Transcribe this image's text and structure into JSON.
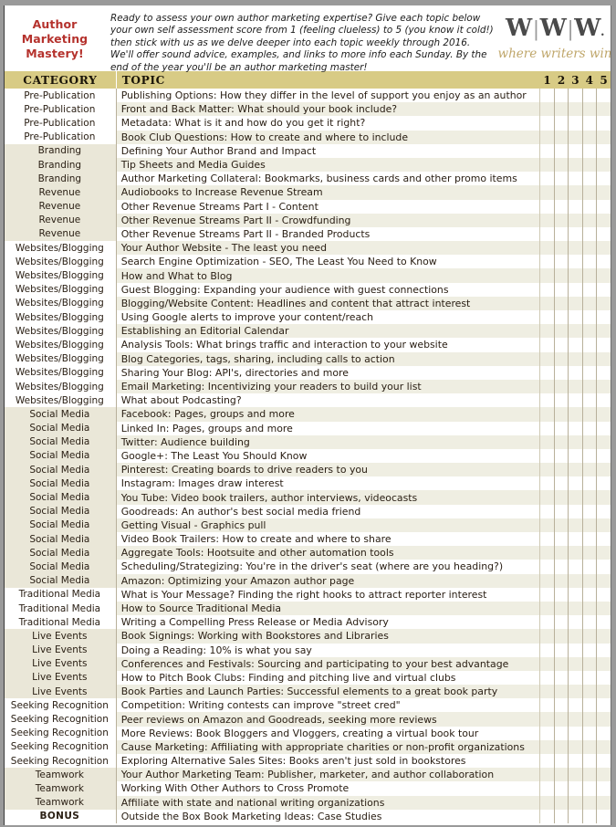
{
  "header": {
    "title": "Author Marketing Mastery!",
    "intro": "Ready to assess your own author marketing expertise? Give each topic below your own self assessment score from 1 (feeling clueless) to 5 (you know it cold!) then stick with us as we delve deeper into each topic weekly through 2016. We'll offer sound advice, examples, and links to more info each Sunday. By the end of the year you'll be an author marketing master!",
    "logo_text": "W|W|W.",
    "logo_tagline": "where writers win",
    "colors": {
      "title_red": "#b5322d",
      "header_gold": "#d8cb85",
      "logo_tan": "#bfa66a",
      "row_alt": "#efeee2",
      "group_shade": "#eae7d8",
      "text": "#2b2015"
    }
  },
  "table": {
    "columns": {
      "category": "CATEGORY",
      "topic": "TOPIC",
      "scores": [
        "1",
        "2",
        "3",
        "4",
        "5"
      ]
    },
    "rows": [
      {
        "category": "Pre-Publication",
        "topic": "Publishing Options: How they differ in the level of support you enjoy as an author",
        "group": 0
      },
      {
        "category": "Pre-Publication",
        "topic": "Front and Back Matter: What should your book include?",
        "group": 0
      },
      {
        "category": "Pre-Publication",
        "topic": "Metadata: What is it and how do you get it right?",
        "group": 0
      },
      {
        "category": "Pre-Publication",
        "topic": "Book Club Questions: How to create and where to include",
        "group": 0
      },
      {
        "category": "Branding",
        "topic": "Defining Your Author Brand and Impact",
        "group": 1
      },
      {
        "category": "Branding",
        "topic": "Tip Sheets and Media Guides",
        "group": 1
      },
      {
        "category": "Branding",
        "topic": "Author Marketing Collateral: Bookmarks, business cards and other promo items",
        "group": 1
      },
      {
        "category": "Revenue",
        "topic": "Audiobooks to Increase Revenue Stream",
        "group": 1
      },
      {
        "category": "Revenue",
        "topic": "Other Revenue Streams Part I - Content",
        "group": 1
      },
      {
        "category": "Revenue",
        "topic": "Other Revenue Streams Part II - Crowdfunding",
        "group": 1
      },
      {
        "category": "Revenue",
        "topic": "Other Revenue Streams Part II - Branded Products",
        "group": 1
      },
      {
        "category": "Websites/Blogging",
        "topic": "Your Author Website - The least you need",
        "group": 0
      },
      {
        "category": "Websites/Blogging",
        "topic": "Search Engine Optimization - SEO, The Least You Need to Know",
        "group": 0
      },
      {
        "category": "Websites/Blogging",
        "topic": "How and What to Blog",
        "group": 0
      },
      {
        "category": "Websites/Blogging",
        "topic": "Guest Blogging: Expanding your audience with guest connections",
        "group": 0
      },
      {
        "category": "Websites/Blogging",
        "topic": "Blogging/Website Content: Headlines and content that attract interest",
        "group": 0
      },
      {
        "category": "Websites/Blogging",
        "topic": "Using Google alerts to improve your content/reach",
        "group": 0
      },
      {
        "category": "Websites/Blogging",
        "topic": "Establishing an Editorial Calendar",
        "group": 0
      },
      {
        "category": "Websites/Blogging",
        "topic": "Analysis Tools: What brings traffic and interaction to your website",
        "group": 0
      },
      {
        "category": "Websites/Blogging",
        "topic": "Blog Categories, tags, sharing, including calls to action",
        "group": 0
      },
      {
        "category": "Websites/Blogging",
        "topic": "Sharing Your Blog: API's, directories and more",
        "group": 0
      },
      {
        "category": "Websites/Blogging",
        "topic": "Email Marketing: Incentivizing your readers to build your list",
        "group": 0
      },
      {
        "category": "Websites/Blogging",
        "topic": "What about Podcasting?",
        "group": 0
      },
      {
        "category": "Social Media",
        "topic": "Facebook: Pages, groups and more",
        "group": 1
      },
      {
        "category": "Social Media",
        "topic": "Linked In: Pages, groups and more",
        "group": 1
      },
      {
        "category": "Social Media",
        "topic": "Twitter: Audience building",
        "group": 1
      },
      {
        "category": "Social Media",
        "topic": "Google+: The Least You Should Know",
        "group": 1
      },
      {
        "category": "Social Media",
        "topic": "Pinterest: Creating boards to drive readers to you",
        "group": 1
      },
      {
        "category": "Social Media",
        "topic": "Instagram: Images draw interest",
        "group": 1
      },
      {
        "category": "Social Media",
        "topic": "You Tube: Video book trailers, author interviews, videocasts",
        "group": 1
      },
      {
        "category": "Social Media",
        "topic": "Goodreads: An author's best social media friend",
        "group": 1
      },
      {
        "category": "Social Media",
        "topic": "Getting Visual - Graphics pull",
        "group": 1
      },
      {
        "category": "Social Media",
        "topic": "Video Book Trailers: How to create and where to share",
        "group": 1
      },
      {
        "category": "Social Media",
        "topic": "Aggregate Tools: Hootsuite and other automation tools",
        "group": 1
      },
      {
        "category": "Social Media",
        "topic": "Scheduling/Strategizing: You're in the driver's seat (where are you heading?)",
        "group": 1
      },
      {
        "category": "Social Media",
        "topic": "Amazon: Optimizing your Amazon author page",
        "group": 1
      },
      {
        "category": "Traditional Media",
        "topic": "What is Your Message? Finding the right hooks to attract reporter interest",
        "group": 0
      },
      {
        "category": "Traditional Media",
        "topic": "How to Source Traditional Media",
        "group": 0
      },
      {
        "category": "Traditional Media",
        "topic": "Writing a Compelling Press Release or Media Advisory",
        "group": 0
      },
      {
        "category": "Live Events",
        "topic": "Book Signings: Working with Bookstores and Libraries",
        "group": 1
      },
      {
        "category": "Live Events",
        "topic": "Doing a Reading: 10% is what you say",
        "group": 1
      },
      {
        "category": "Live Events",
        "topic": "Conferences and Festivals: Sourcing and participating to your best advantage",
        "group": 1
      },
      {
        "category": "Live Events",
        "topic": "How to Pitch Book Clubs: Finding and pitching live and virtual clubs",
        "group": 1
      },
      {
        "category": "Live Events",
        "topic": "Book Parties and Launch Parties: Successful elements to a great book party",
        "group": 1
      },
      {
        "category": "Seeking Recognition",
        "topic": "Competition: Writing contests can improve \"street cred\"",
        "group": 0
      },
      {
        "category": "Seeking Recognition",
        "topic": "Peer reviews on Amazon and Goodreads, seeking more reviews",
        "group": 0
      },
      {
        "category": "Seeking Recognition",
        "topic": "More Reviews: Book Bloggers and Vloggers, creating a virtual book tour",
        "group": 0
      },
      {
        "category": "Seeking Recognition",
        "topic": "Cause Marketing: Affiliating with appropriate charities or non-profit organizations",
        "group": 0
      },
      {
        "category": "Seeking Recognition",
        "topic": "Exploring Alternative Sales Sites: Books aren't just sold in bookstores",
        "group": 0
      },
      {
        "category": "Teamwork",
        "topic": "Your Author Marketing Team: Publisher, marketer, and author collaboration",
        "group": 1
      },
      {
        "category": "Teamwork",
        "topic": "Working With Other Authors to Cross Promote",
        "group": 1
      },
      {
        "category": "Teamwork",
        "topic": "Affiliate with state and national writing organizations",
        "group": 1
      },
      {
        "category": "BONUS",
        "topic": "Outside the Box Book Marketing Ideas: Case Studies",
        "group": 2
      }
    ]
  }
}
